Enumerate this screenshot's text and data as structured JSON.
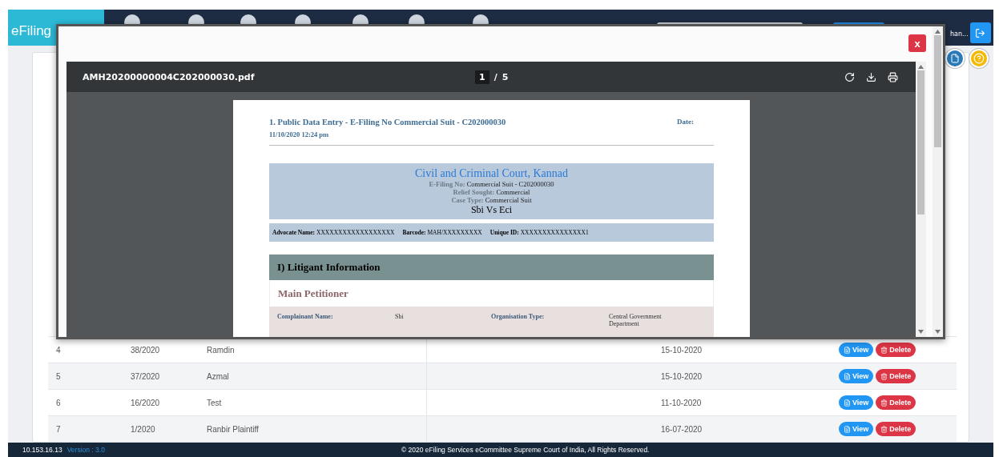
{
  "header": {
    "brand": "eFiling",
    "user": "han..."
  },
  "table": {
    "rows": [
      {
        "serial": "4",
        "number": "38/2020",
        "name": "Ramdin",
        "date": "15-10-2020",
        "actions": [
          "View",
          "Delete"
        ]
      },
      {
        "serial": "5",
        "number": "37/2020",
        "name": "Azmal",
        "date": "15-10-2020",
        "actions": [
          "View",
          "Delete"
        ]
      },
      {
        "serial": "6",
        "number": "16/2020",
        "name": "Test",
        "date": "11-10-2020",
        "actions": [
          "View",
          "Delete"
        ]
      },
      {
        "serial": "7",
        "number": "1/2020",
        "name": "Ranbir Plaintiff",
        "date": "16-07-2020",
        "actions": [
          "View",
          "Delete"
        ]
      }
    ]
  },
  "footer": {
    "ip": "10.153.16.13",
    "version": "Version : 3.0",
    "copyright": "© 2020 eFiling Services eCommittee Supreme Court of India, All Rights Reserved."
  },
  "modal": {
    "close": "x",
    "viewer": {
      "filename": "AMH20200000004C202000030.pdf",
      "page": "1",
      "page_sep": "/",
      "total": "5"
    },
    "document": {
      "title": "1. Public Data Entry - E-Filing No Commercial Suit - C202000030",
      "date_label": "Date:",
      "datetime": "11/10/2020 12:24 pm",
      "court": "Civil and Criminal Court, Kannad",
      "court_lines": [
        {
          "label": "E-Filing No:",
          "value": "Commercial Suit - C202000030"
        },
        {
          "label": "Relief Sought:",
          "value": "Commercial"
        },
        {
          "label": "Case Type:",
          "value": "Commercial Suit"
        }
      ],
      "parties": "Sbi Vs Eci",
      "advocate": [
        {
          "label": "Advocate Name:",
          "value": "XXXXXXXXXXXXXXXXXX"
        },
        {
          "label": "Barcode:",
          "value": "MAH/XXXXXXXXX"
        },
        {
          "label": "Unique ID:",
          "value": "XXXXXXXXXXXXXXX1"
        }
      ],
      "section": "I) Litigant Information",
      "subsection": "Main Petitioner",
      "fields": [
        {
          "label": "Complainant Name:",
          "value": "Sbi"
        },
        {
          "label": "Organisation Type:",
          "value": "Central Government Department"
        }
      ]
    }
  }
}
